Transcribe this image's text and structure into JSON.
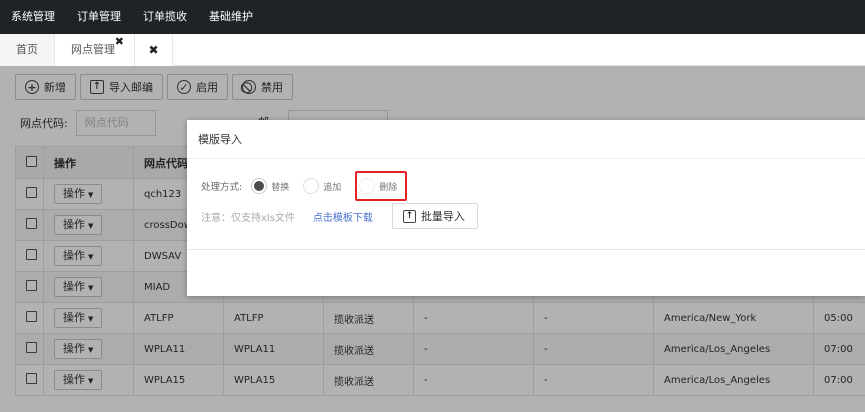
{
  "topnav": {
    "items": [
      "系统管理",
      "订单管理",
      "订单揽收",
      "基础维护"
    ]
  },
  "tabs": {
    "home": "首页",
    "outlets": "网点管理",
    "outlets_close": "✖",
    "extra_close": "✖"
  },
  "toolbar": {
    "add_label": "新增",
    "import_postcode_label": "导入邮编",
    "enable_label": "启用",
    "disable_label": "禁用"
  },
  "filter": {
    "outlet_code_label": "网点代码:",
    "outlet_code_placeholder": "网点代码",
    "postcode_label": "邮编"
  },
  "table": {
    "headers": [
      "操作",
      "网点代码"
    ],
    "op_label": "操作",
    "rows": [
      {
        "code": "qch123",
        "c3": "",
        "c4": "",
        "c5": "",
        "c6": "",
        "c7": "",
        "c8": ""
      },
      {
        "code": "crossDow",
        "c3": "",
        "c4": "",
        "c5": "",
        "c6": "",
        "c7": "",
        "c8": ""
      },
      {
        "code": "DWSAV",
        "c3": "",
        "c4": "",
        "c5": "",
        "c6": "",
        "c7": "",
        "c8": ""
      },
      {
        "code": "MIAD",
        "c3": "",
        "c4": "",
        "c5": "",
        "c6": "",
        "c7": "",
        "c8": ""
      },
      {
        "code": "ATLFP",
        "c3": "ATLFP",
        "c4": "揽收派送",
        "c5": "-",
        "c6": "-",
        "c7": "America/New_York",
        "c8": "05:00"
      },
      {
        "code": "WPLA11",
        "c3": "WPLA11",
        "c4": "揽收派送",
        "c5": "-",
        "c6": "-",
        "c7": "America/Los_Angeles",
        "c8": "07:00"
      },
      {
        "code": "WPLA15",
        "c3": "WPLA15",
        "c4": "揽收派送",
        "c5": "-",
        "c6": "-",
        "c7": "America/Los_Angeles",
        "c8": "07:00"
      }
    ]
  },
  "modal": {
    "title": "模版导入",
    "process_label": "处理方式:",
    "opt_replace": "替换",
    "opt_append": "追加",
    "opt_delete": "删除",
    "note": "注意：仅支持xls文件",
    "download_link": "点击模板下载",
    "import_button": "批量导入"
  }
}
